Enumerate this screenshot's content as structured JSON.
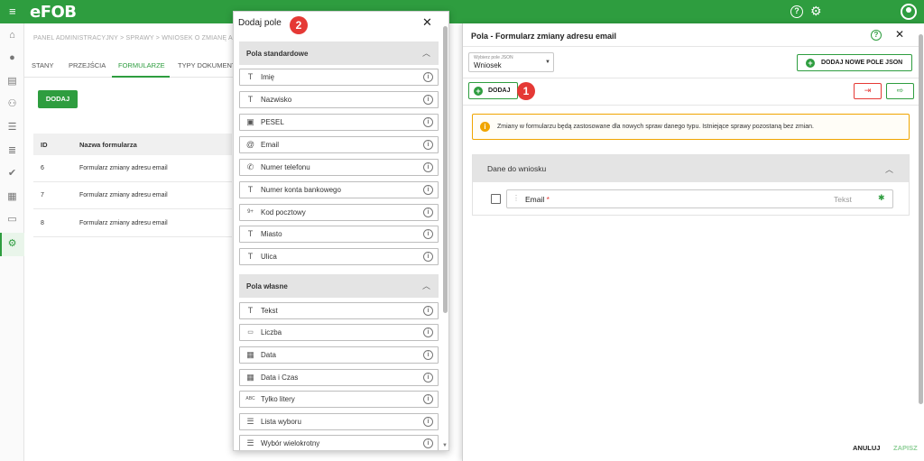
{
  "app": {
    "logo": "eFOB",
    "accent": "#2e9d3f",
    "icons": [
      "menu-icon",
      "help-icon",
      "settings-gear-icon",
      "account-icon"
    ]
  },
  "leftnav": {
    "items": [
      "home-icon",
      "person-icon",
      "document-icon",
      "people-icon",
      "person-list-icon",
      "list-icon",
      "check-circle-icon",
      "file-icon",
      "folder-icon",
      "settings-icon"
    ],
    "active_index": 9
  },
  "background": {
    "breadcrumb": "PANEL ADMINISTRACYJNY  >  SPRAWY  >  WNIOSEK O ZMIANĘ A",
    "tabs": [
      "STANY",
      "PRZEJŚCIA",
      "FORMULARZE",
      "TYPY DOKUMENT"
    ],
    "active_tab": 2,
    "add_button": "DODAJ",
    "table": {
      "headers": [
        "ID",
        "Nazwa formularza"
      ],
      "rows": [
        {
          "id": "6",
          "name": "Formularz zmiany adresu email"
        },
        {
          "id": "7",
          "name": "Formularz zmiany adresu email"
        },
        {
          "id": "8",
          "name": "Formularz zmiany adresu email"
        }
      ]
    }
  },
  "modal": {
    "title": "Dodaj pole",
    "badge": "2",
    "close_icon": "close-icon",
    "sections": [
      {
        "label": "Pola standardowe",
        "items": [
          {
            "icon": "text-icon",
            "label": "Imię"
          },
          {
            "icon": "text-icon",
            "label": "Nazwisko"
          },
          {
            "icon": "id-card-icon",
            "label": "PESEL"
          },
          {
            "icon": "at-icon",
            "label": "Email"
          },
          {
            "icon": "phone-icon",
            "label": "Numer telefonu"
          },
          {
            "icon": "text-icon",
            "label": "Numer konta bankowego"
          },
          {
            "icon": "postal-code-icon",
            "label": "Kod pocztowy"
          },
          {
            "icon": "text-icon",
            "label": "Miasto"
          },
          {
            "icon": "text-icon",
            "label": "Ulica"
          }
        ]
      },
      {
        "label": "Pola własne",
        "items": [
          {
            "icon": "text-icon",
            "label": "Tekst"
          },
          {
            "icon": "number-icon",
            "label": "Liczba"
          },
          {
            "icon": "calendar-icon",
            "label": "Data"
          },
          {
            "icon": "calendar-clock-icon",
            "label": "Data i Czas"
          },
          {
            "icon": "letters-icon",
            "label": "Tylko litery"
          },
          {
            "icon": "list-select-icon",
            "label": "Lista wyboru"
          },
          {
            "icon": "multi-select-icon",
            "label": "Wybór wielokrotny"
          }
        ]
      }
    ]
  },
  "panel": {
    "title": "Pola - Formularz zmiany adresu email",
    "select": {
      "label": "Wybierz pole JSON",
      "value": "Wniosek"
    },
    "add_json_button": "DODAJ NOWE POLE JSON",
    "add_button": "DODAJ",
    "badge": "1",
    "alert": "Zmiany w formularzu będą zastosowane dla nowych spraw danego typu. Istniejące sprawy pozostaną bez zmian.",
    "section": "Dane do wniosku",
    "field": {
      "name": "Email",
      "required_mark": "*",
      "type": "Tekst"
    },
    "footer": {
      "cancel": "ANULUJ",
      "save": "ZAPISZ"
    }
  }
}
